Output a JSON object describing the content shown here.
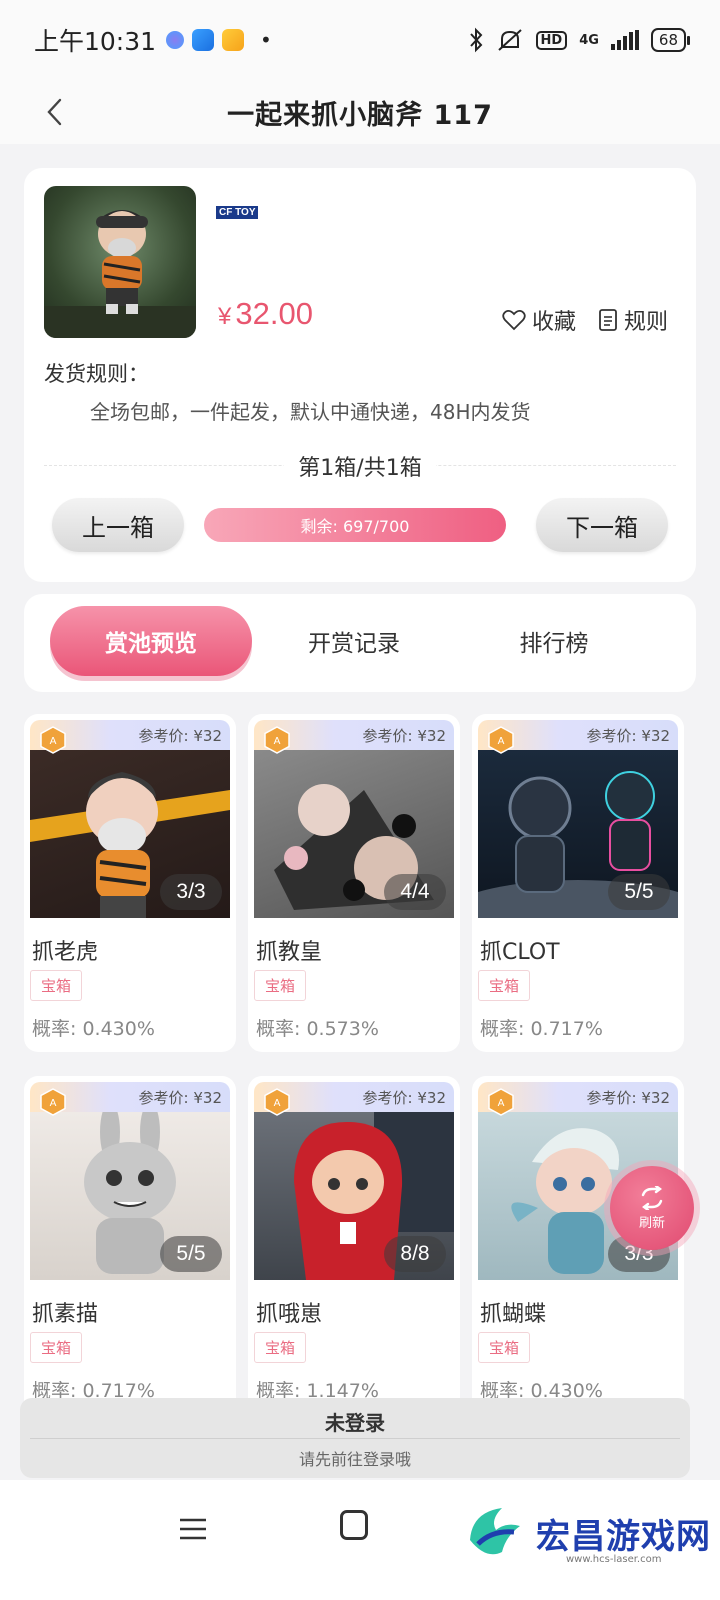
{
  "status_bar": {
    "time": "上午10:31",
    "network": "4G",
    "hd": "HD",
    "battery": "68"
  },
  "header": {
    "title": "一起来抓小脑斧 117",
    "back_icon": "chevron-left-icon"
  },
  "product": {
    "brand": "CF TOY",
    "currency": "¥",
    "price": "32.00",
    "favorite_label": "收藏",
    "rules_label": "规则",
    "shipping_label": "发货规则：",
    "shipping_text": "全场包邮，一件起发，默认中通快递，48H内发货",
    "box_index": "第1箱/共1箱",
    "prev_box": "上一箱",
    "next_box": "下一箱",
    "remaining_text": "剩余: 697/700",
    "remaining": 697,
    "total": 700
  },
  "tabs": [
    {
      "label": "赏池预览",
      "active": true
    },
    {
      "label": "开赏记录",
      "active": false
    },
    {
      "label": "排行榜",
      "active": false
    }
  ],
  "items": [
    {
      "ref_price": "参考价: ¥32",
      "count": "3/3",
      "name": "抓老虎",
      "tag": "宝箱",
      "prob": "概率: 0.430%"
    },
    {
      "ref_price": "参考价: ¥32",
      "count": "4/4",
      "name": "抓教皇",
      "tag": "宝箱",
      "prob": "概率: 0.573%"
    },
    {
      "ref_price": "参考价: ¥32",
      "count": "5/5",
      "name": "抓CLOT",
      "tag": "宝箱",
      "prob": "概率: 0.717%"
    },
    {
      "ref_price": "参考价: ¥32",
      "count": "5/5",
      "name": "抓素描",
      "tag": "宝箱",
      "prob": "概率: 0.717%"
    },
    {
      "ref_price": "参考价: ¥32",
      "count": "8/8",
      "name": "抓哦崽",
      "tag": "宝箱",
      "prob": "概率: 1.147%"
    },
    {
      "ref_price": "参考价: ¥32",
      "count": "3/3",
      "name": "抓蝴蝶",
      "tag": "宝箱",
      "prob": "概率: 0.430%"
    }
  ],
  "refresh": {
    "label": "刷新"
  },
  "login": {
    "title": "未登录",
    "subtitle": "请先前往登录哦"
  },
  "watermark": {
    "text": "宏昌游戏网",
    "url": "www.hcs-laser.com"
  },
  "colors": {
    "accent": "#ea5678",
    "price": "#e8566f",
    "brand_blue": "#1f3fae"
  }
}
